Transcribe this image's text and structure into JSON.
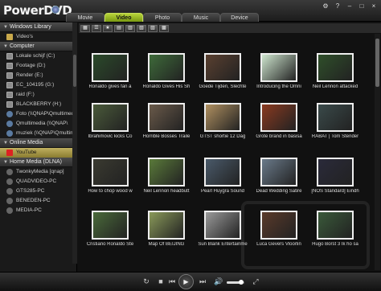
{
  "app": {
    "title": "PowerDVD"
  },
  "tabs": [
    {
      "label": "Movie",
      "active": false
    },
    {
      "label": "Video",
      "active": true
    },
    {
      "label": "Photo",
      "active": false
    },
    {
      "label": "Music",
      "active": false
    },
    {
      "label": "Device",
      "active": false
    }
  ],
  "window_controls": {
    "settings": "⚙",
    "help": "?",
    "minimize": "–",
    "maximize": "□",
    "close": "×"
  },
  "sidebar": {
    "sections": [
      {
        "label": "Windows Library",
        "items": [
          {
            "label": "Video's",
            "icon": "folder"
          }
        ]
      },
      {
        "label": "Computer",
        "items": [
          {
            "label": "Lokale schijf (C:)",
            "icon": "drive"
          },
          {
            "label": "Footage (D:)",
            "icon": "drive"
          },
          {
            "label": "Render (E:)",
            "icon": "drive"
          },
          {
            "label": "EC_104195 (G:)",
            "icon": "drive"
          },
          {
            "label": "raid (F:)",
            "icon": "drive"
          },
          {
            "label": "BLACKBERRY (H:)",
            "icon": "drive"
          },
          {
            "label": "Foto (\\\\QNAP\\Qmultimedi",
            "icon": "net"
          },
          {
            "label": "Qmultimedia (\\\\QNAP\\",
            "icon": "net"
          },
          {
            "label": "muziek (\\\\QNAP\\Qmultimedi",
            "icon": "net"
          }
        ]
      },
      {
        "label": "Online Media",
        "items": [
          {
            "label": "YouTube",
            "icon": "youtube",
            "selected": true
          }
        ]
      },
      {
        "label": "Home Media (DLNA)",
        "items": [
          {
            "label": "TwonkyMedia [qnap]",
            "icon": "dlna"
          },
          {
            "label": "QUADVIDEO-PC",
            "icon": "dlna"
          },
          {
            "label": "GTS285-PC",
            "icon": "dlna"
          },
          {
            "label": "BENEDEN-PC",
            "icon": "dlna"
          },
          {
            "label": "MEDIA-PC",
            "icon": "dlna"
          }
        ]
      }
    ]
  },
  "toolbar": {
    "buttons": [
      "grid-view",
      "list-view",
      "favorite",
      "view-1",
      "view-2",
      "view-3",
      "view-4",
      "view-5"
    ]
  },
  "videos": [
    {
      "caption": "Ronaldo gives fan a",
      "color": "#2b4a2a"
    },
    {
      "caption": "Ronaldo Gives His Sh",
      "color": "#3e6b3a"
    },
    {
      "caption": "Goede Tijden, Slechte",
      "color": "#5a4030"
    },
    {
      "caption": "Introducing the Omni",
      "color": "#cfe6cf"
    },
    {
      "caption": "Neil Lennon attacked",
      "color": "#2f4f2a"
    },
    {
      "caption": "Ibrahimovic kicks Co",
      "color": "#4a5a3a"
    },
    {
      "caption": "Horrible Bosses Traile",
      "color": "#6a5a4a"
    },
    {
      "caption": "GTST shortie 12 Dag",
      "color": "#b09060"
    },
    {
      "caption": "Grote brand in basisa",
      "color": "#8a3a20"
    },
    {
      "caption": "RABAT | Tom Stender",
      "color": "#3a4a4a"
    },
    {
      "caption": "How to chop wood w",
      "color": "#3a3a30"
    },
    {
      "caption": "Neil Lennon headbutt",
      "color": "#5a7a3a"
    },
    {
      "caption": "Pearl Huygra Sound",
      "color": "#4a5a6a"
    },
    {
      "caption": "Dead Wedding Satire",
      "color": "#6a7a8a"
    },
    {
      "caption": "[NOS Standard] Eindh",
      "color": "#2a2a3a"
    },
    {
      "caption": "Cristiano Ronaldo Ste",
      "color": "#4a6a3a"
    },
    {
      "caption": "Map Of BEIJING",
      "color": "#8a9a5a"
    },
    {
      "caption": "Sun Blank Entertainme",
      "color": "#9a9a9a"
    },
    {
      "caption": "Luca Gevers Vloorlin",
      "color": "#5a3a2a"
    },
    {
      "caption": "Hugo Borst 3 Ik ho sa",
      "color": "#3a5a3a"
    }
  ],
  "player": {
    "repeat": "↻",
    "stop": "■",
    "prev": "⏮",
    "play": "▶",
    "next": "⏭",
    "volume_icon": "🔊",
    "volume_level": 0.8,
    "fullscreen": "⤢"
  }
}
